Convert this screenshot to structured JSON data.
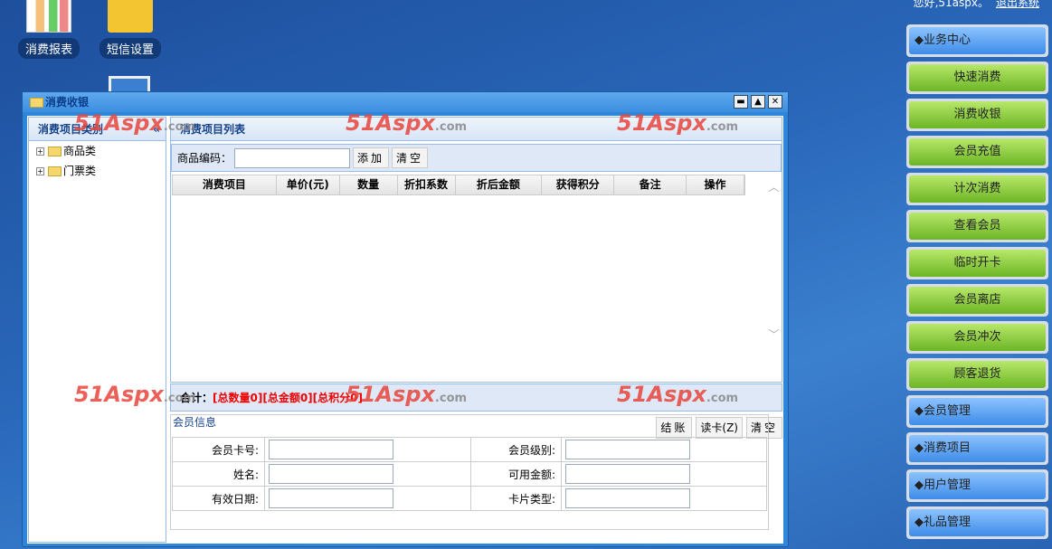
{
  "topbar": {
    "greeting": "您好,51aspx。",
    "logout": "退出系统"
  },
  "desktop": [
    {
      "label": "消费报表"
    },
    {
      "label": "短信设置"
    }
  ],
  "sidebar": [
    {
      "label": "◆业务中心",
      "style": "blue"
    },
    {
      "label": "快速消费",
      "style": "green"
    },
    {
      "label": "消费收银",
      "style": "green"
    },
    {
      "label": "会员充值",
      "style": "green"
    },
    {
      "label": "计次消费",
      "style": "green"
    },
    {
      "label": "查看会员",
      "style": "green"
    },
    {
      "label": "临时开卡",
      "style": "green"
    },
    {
      "label": "会员离店",
      "style": "green"
    },
    {
      "label": "会员冲次",
      "style": "green"
    },
    {
      "label": "顾客退货",
      "style": "green"
    },
    {
      "label": "◆会员管理",
      "style": "blue"
    },
    {
      "label": "◆消费项目",
      "style": "blue"
    },
    {
      "label": "◆用户管理",
      "style": "blue"
    },
    {
      "label": "◆礼品管理",
      "style": "blue"
    }
  ],
  "window": {
    "title": "消费收银",
    "min": "▬",
    "max": "▲",
    "close": "✕",
    "left": {
      "title": "消费项目类别",
      "collapse": "«",
      "tree": [
        {
          "label": "商品类"
        },
        {
          "label": "门票类"
        }
      ]
    },
    "list": {
      "title": "消费项目列表",
      "code_label": "商品编码：",
      "code_value": "",
      "add": "添加",
      "clear": "清空",
      "columns": [
        "消费项目",
        "单价(元)",
        "数量",
        "折扣系数",
        "折后金额",
        "获得积分",
        "备注",
        "操作"
      ],
      "up": "︿",
      "down": "﹀"
    },
    "summary": {
      "label": "合计：",
      "qty": "[总数量0]",
      "amount": "[总金额0]",
      "points": "[总积分0]"
    },
    "actions": {
      "checkout": "结账",
      "read_card": "读卡(Z)",
      "clear": "清空"
    },
    "member": {
      "legend": "会员信息",
      "fields": [
        [
          "会员卡号:",
          "会员级别:"
        ],
        [
          "姓名:",
          "可用金额:"
        ],
        [
          "有效日期:",
          "卡片类型:"
        ]
      ]
    }
  },
  "watermark": {
    "text": "51Aspx",
    ".com": ".com"
  }
}
